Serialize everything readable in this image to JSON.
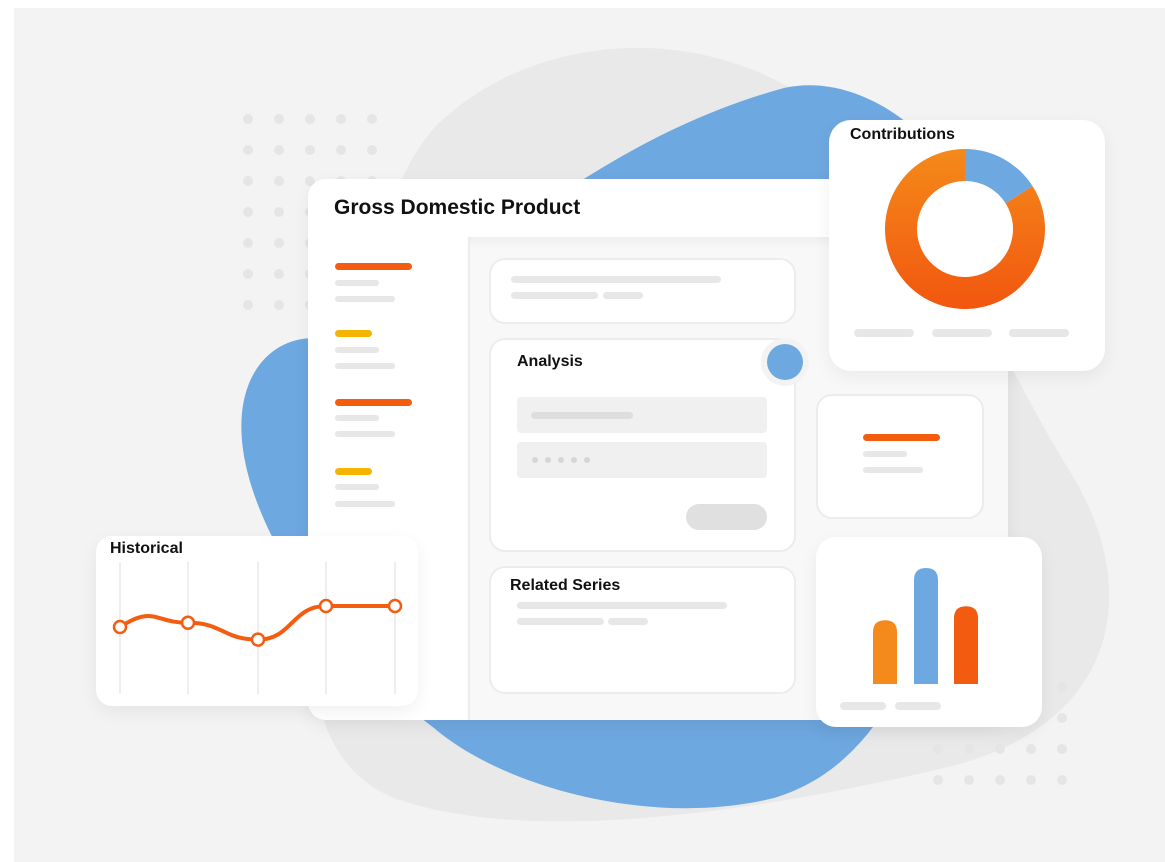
{
  "main_window": {
    "title": "Gross Domestic Product"
  },
  "analysis_card": {
    "title": "Analysis"
  },
  "related_card": {
    "title": "Related Series"
  },
  "historical_card": {
    "title": "Historical",
    "chart_data": {
      "type": "line",
      "points": [
        1,
        2,
        3,
        4,
        5
      ],
      "values": [
        0.5,
        0.6,
        0.2,
        1.0,
        1.0
      ]
    }
  },
  "contributions_card": {
    "title": "Contributions",
    "chart_data": {
      "type": "pie",
      "slices": [
        {
          "value": 0.16,
          "color": "#6ea8e0"
        },
        {
          "value": 0.84,
          "color": "#f07a17"
        }
      ]
    }
  },
  "bar_card": {
    "chart_data": {
      "type": "bar",
      "values": [
        0.55,
        1.0,
        0.67
      ],
      "colors": [
        "#f58a1c",
        "#6ea8e0",
        "#f25b10"
      ]
    }
  },
  "colors": {
    "blob_blue": "#6ea8e0",
    "orange": "#f45d10",
    "yellow": "#f4b400",
    "grey_blob": "#e9e9e9"
  }
}
